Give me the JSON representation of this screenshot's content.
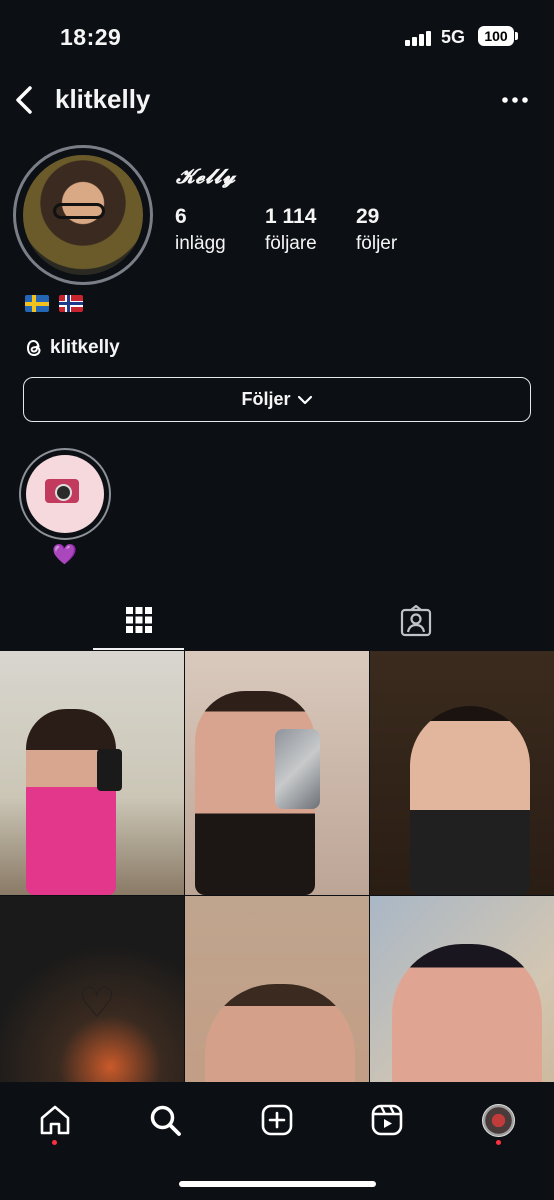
{
  "status_bar": {
    "time": "18:29",
    "network": "5G",
    "battery": "100"
  },
  "header": {
    "username": "klitkelly"
  },
  "profile": {
    "display_name": "𝓚𝓮𝓵𝓵𝔂",
    "stats": [
      {
        "value": "6",
        "label": "inlägg"
      },
      {
        "value": "1 114",
        "label": "följare"
      },
      {
        "value": "29",
        "label": "följer"
      }
    ],
    "flags": [
      "sweden-flag",
      "norway-flag"
    ],
    "threads_handle": "klitkelly"
  },
  "follow_button": {
    "label": "Följer"
  },
  "highlights": [
    {
      "label": "💜",
      "icon": "camera-icon"
    }
  ],
  "tabs": [
    {
      "name": "grid",
      "active": true
    },
    {
      "name": "tagged",
      "active": false
    }
  ],
  "bottom_nav": [
    {
      "name": "home",
      "notify": true
    },
    {
      "name": "search",
      "notify": false
    },
    {
      "name": "create",
      "notify": false
    },
    {
      "name": "reels",
      "notify": false
    },
    {
      "name": "profile",
      "notify": true
    }
  ],
  "colors": {
    "background": "#0c0f14",
    "notify_dot": "#ff3040",
    "highlight_heart": "#a855f7"
  }
}
